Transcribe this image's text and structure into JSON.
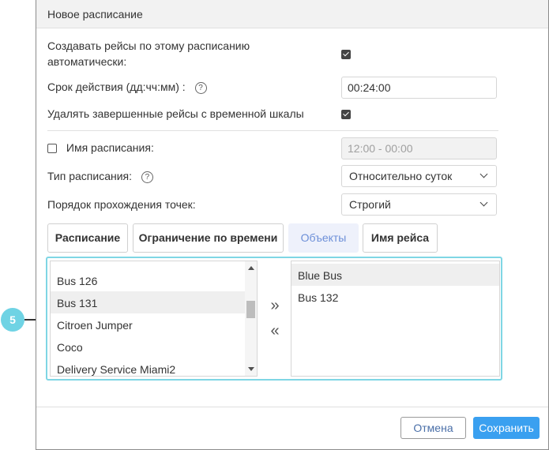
{
  "dialog": {
    "title": "Новое расписание"
  },
  "form": {
    "auto_create_label": "Создавать рейсы по этому расписанию автоматически:",
    "validity_label": "Срок действия (дд:чч:мм)  :",
    "validity_value": "00:24:00",
    "delete_completed_label": "Удалять завершенные рейсы с временной шкалы",
    "schedule_name_label": "Имя расписания:",
    "schedule_name_placeholder": "12:00 - 00:00",
    "schedule_type_label": "Тип расписания:",
    "schedule_type_value": "Относительно суток",
    "point_order_label": "Порядок прохождения точек:",
    "point_order_value": "Строгий"
  },
  "tabs": [
    {
      "label": "Расписание"
    },
    {
      "label": "Ограничение по времени"
    },
    {
      "label": "Объекты"
    },
    {
      "label": "Имя рейса"
    }
  ],
  "available_units": [
    "Bus 126",
    "Bus 131",
    "Citroen Jumper",
    "Coco",
    "Delivery Service Miami2"
  ],
  "selected_units": [
    "Blue Bus",
    "Bus 132"
  ],
  "move_buttons": {
    "add": "»",
    "remove": "«"
  },
  "buttons": {
    "cancel": "Отмена",
    "save": "Сохранить"
  },
  "callout": {
    "number": "5"
  },
  "colors": {
    "accent": "#3aa0f0",
    "highlight_border": "#7fd6e4",
    "active_tab_text": "#6c8fd8"
  }
}
